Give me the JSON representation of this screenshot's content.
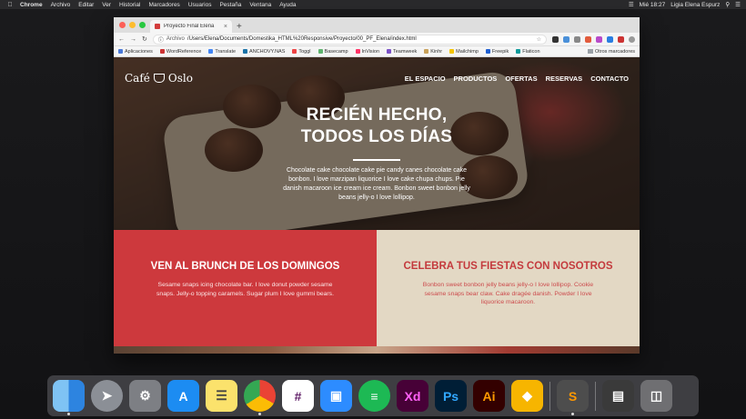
{
  "menubar": {
    "apple": "",
    "items": [
      "Chrome",
      "Archivo",
      "Editar",
      "Ver",
      "Historial",
      "Marcadores",
      "Usuarios",
      "Pestaña",
      "Ventana",
      "Ayuda"
    ],
    "clock": "Mié 18:27",
    "user": "Ligia Elena Espurz"
  },
  "browser": {
    "tab_title": "Proyecto Final Elena",
    "url_prefix": "Archivo",
    "url": "/Users/Elena/Documents/Domestika_HTML%20Responsive/Proyecto/00_PF_Elena/index.html",
    "bookmarks": [
      "Aplicaciones",
      "WordReference",
      "Translate",
      "ANCHOVY.NAS",
      "Toggl",
      "Basecamp",
      "InVision",
      "Teamweek",
      "Kinhr",
      "Mailchimp",
      "Freepik",
      "Flaticon"
    ],
    "other_bookmarks": "Otros marcadores"
  },
  "site": {
    "logo_left": "Café",
    "logo_right": "Oslo",
    "nav": [
      "EL ESPACIO",
      "PRODUCTOS",
      "OFERTAS",
      "RESERVAS",
      "CONTACTO"
    ],
    "hero_title_1": "RECIÉN HECHO,",
    "hero_title_2": "TODOS LOS DÍAS",
    "hero_text": "Chocolate cake chocolate cake pie candy canes chocolate cake bonbon. I love marzipan liquorice I love cake chupa chups. Pie danish macaroon ice cream ice cream. Bonbon sweet bonbon jelly beans jelly-o I love lollipop.",
    "card1_title": "VEN AL BRUNCH DE LOS DOMINGOS",
    "card1_text": "Sesame snaps icing chocolate bar. I love donut powder sesame snaps. Jelly-o topping caramels. Sugar plum I love gummi bears.",
    "card2_title": "CELEBRA TUS FIESTAS CON NOSOTROS",
    "card2_text": "Bonbon sweet bonbon jelly beans jelly-o I love lollipop. Cookie sesame snaps bear claw. Cake dragée danish. Powder I love liquorice macaroon."
  },
  "dock": {
    "labels": [
      "Xd",
      "Ps",
      "Ai"
    ]
  },
  "colors": {
    "accent_red": "#cd393d",
    "cream": "#e3d8c4"
  }
}
